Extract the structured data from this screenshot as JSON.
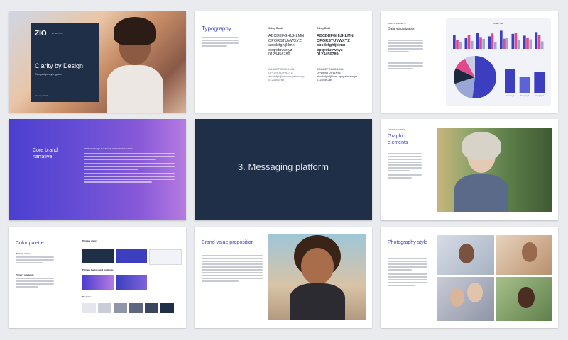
{
  "slides": {
    "cover": {
      "logo": "ZIO",
      "logo_sub": "BY IRHYTHM",
      "title": "Clarity by Design",
      "subtitle": "Campaign style guide",
      "date": "January 2023"
    },
    "typography": {
      "title": "Typography",
      "col1_title": "Gilroy Book",
      "col2_title": "Gilroy Bold",
      "upper": "ABCDEFGHIJKLMN OPQRSTUVWXYZ",
      "lower": "abcdefghijklmn opqrstuvwxyz",
      "digits": "0123456789"
    },
    "dataviz": {
      "eyebrow": "GRAPHIC ELEMENTS",
      "title": "Data visualization",
      "chart_title": "Chart Title"
    },
    "core": {
      "title": "Core brand narrative",
      "lead": "Clarity by Design. Leadership in Cardiac Innovation."
    },
    "messaging": {
      "title": "3.  Messaging platform"
    },
    "graphic": {
      "eyebrow": "GRAPHIC ELEMENTS",
      "title": "Graphic elements"
    },
    "palette": {
      "title": "Color palette",
      "primary_colors": "Primary colors",
      "primary_gradients": "Primary gradients",
      "primary_bg_gradients": "Primary background gradients",
      "neutrals": "Neutrals"
    },
    "value": {
      "title": "Brand value proposition"
    },
    "photo": {
      "title": "Photography style"
    }
  },
  "chart_data": {
    "type": "bar",
    "title": "Chart Title",
    "categories": [
      "1",
      "2",
      "3",
      "4",
      "5",
      "6",
      "7",
      "8"
    ],
    "series": [
      {
        "values": [
          62,
          48,
          70,
          55,
          80,
          66,
          58,
          74
        ]
      },
      {
        "values": [
          40,
          60,
          52,
          68,
          45,
          72,
          50,
          61
        ]
      },
      {
        "values": [
          30,
          35,
          44,
          28,
          50,
          38,
          42,
          33
        ]
      }
    ],
    "colors": [
      "#3b3fbf",
      "#e04a8a",
      "#9aa6d6"
    ]
  },
  "pie_data": {
    "type": "pie",
    "values": [
      52,
      18,
      12,
      10,
      8
    ],
    "colors": [
      "#3b3fbf",
      "#9aa6d6",
      "#1c2740",
      "#e04a8a",
      "#c7cbe6"
    ]
  },
  "small_bars": {
    "type": "bar",
    "categories": [
      "Category 1",
      "Category 2",
      "Category 3"
    ],
    "values": [
      34,
      22,
      30
    ],
    "colors": [
      "#3b3fbf",
      "#5b63d6",
      "#3b3fbf"
    ]
  }
}
